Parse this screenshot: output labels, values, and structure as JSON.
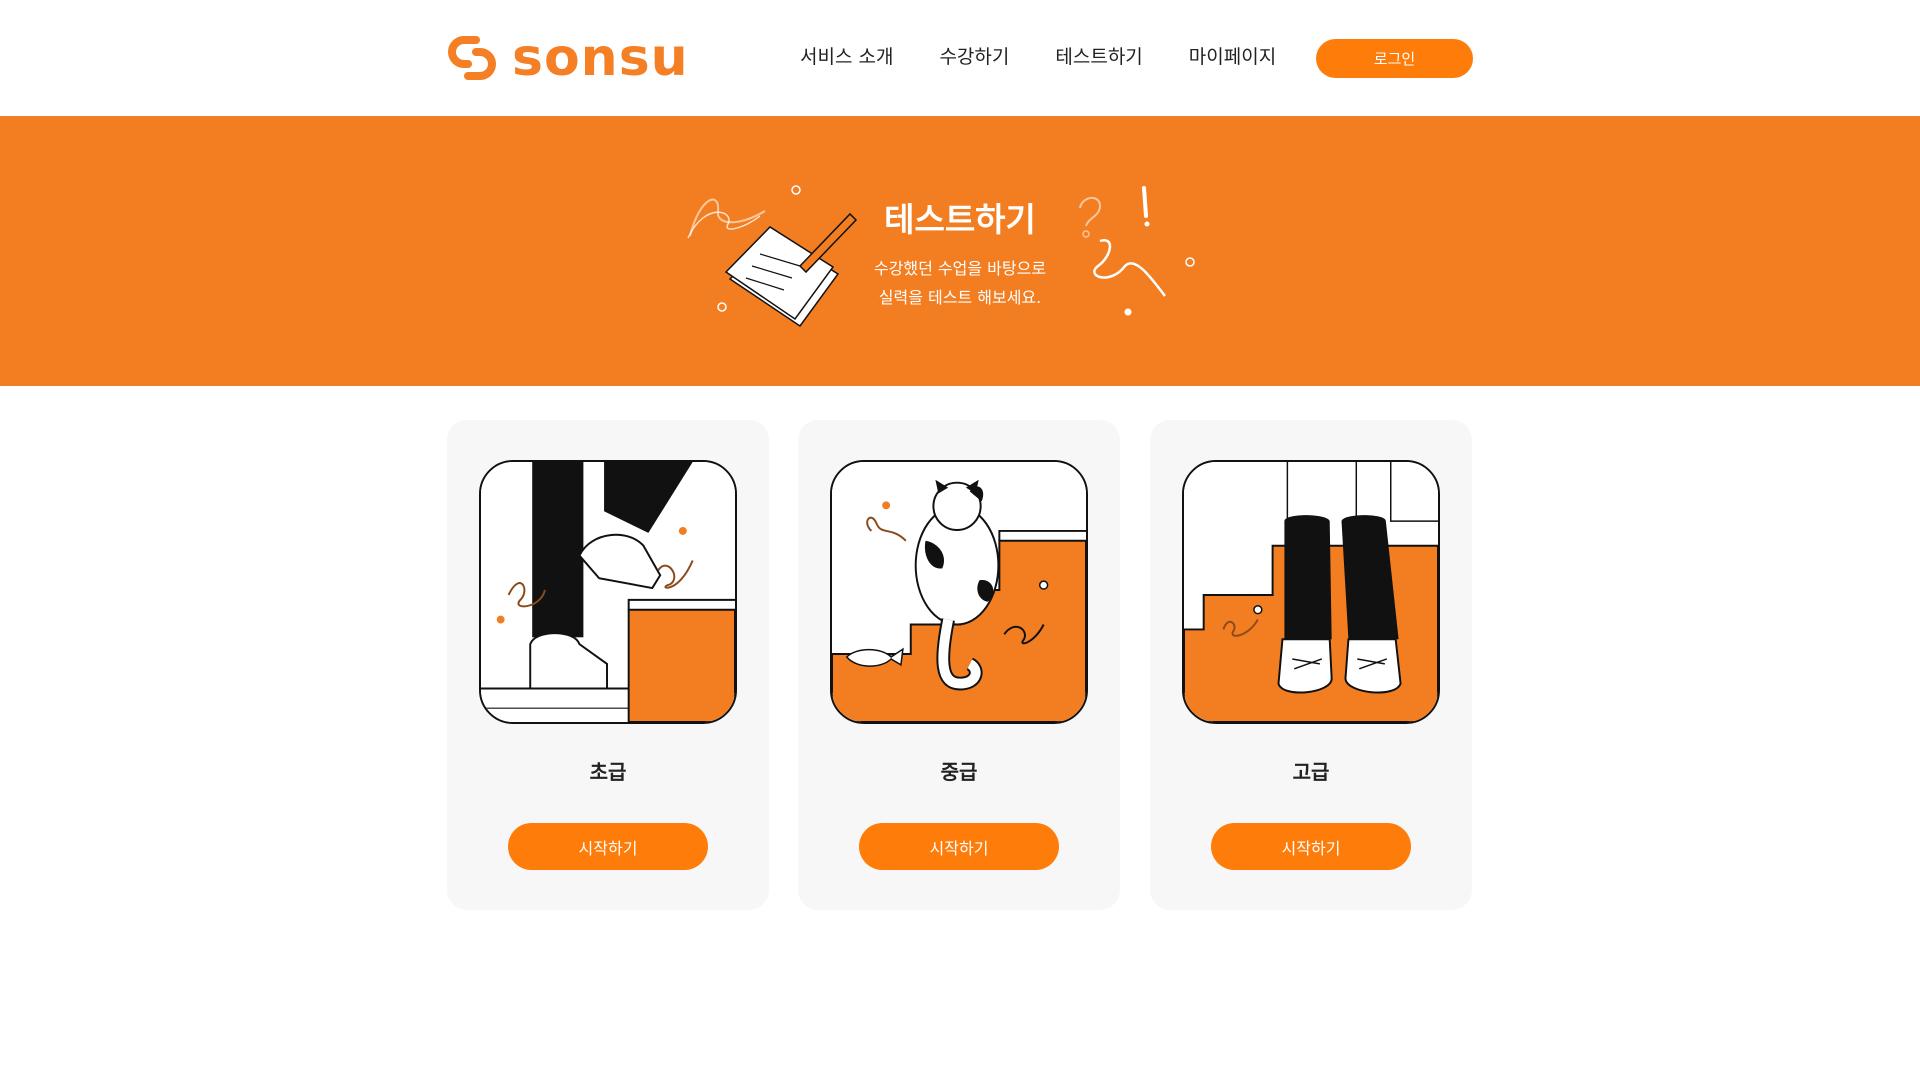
{
  "brand": {
    "name": "sonsu",
    "color": "#f47f24",
    "logo_icon": "link-chain-icon"
  },
  "nav": {
    "items": [
      {
        "label": "서비스 소개"
      },
      {
        "label": "수강하기"
      },
      {
        "label": "테스트하기"
      },
      {
        "label": "마이페이지"
      }
    ],
    "login_label": "로그인"
  },
  "hero": {
    "title": "테스트하기",
    "subtitle_line1": "수강했던 수업을 바탕으로",
    "subtitle_line2": "실력을 테스트 해보세요.",
    "background": "#f37e22",
    "illustration": "paper-and-pencil-icon"
  },
  "levels": [
    {
      "title": "초급",
      "button": "시작하기",
      "illustration": "stepping-up-stairs-illustration"
    },
    {
      "title": "중급",
      "button": "시작하기",
      "illustration": "cat-on-stairs-illustration"
    },
    {
      "title": "고급",
      "button": "시작하기",
      "illustration": "standing-on-stairs-illustration"
    }
  ],
  "colors": {
    "accent": "#fd7c0a",
    "card_bg": "#f7f7f7"
  }
}
